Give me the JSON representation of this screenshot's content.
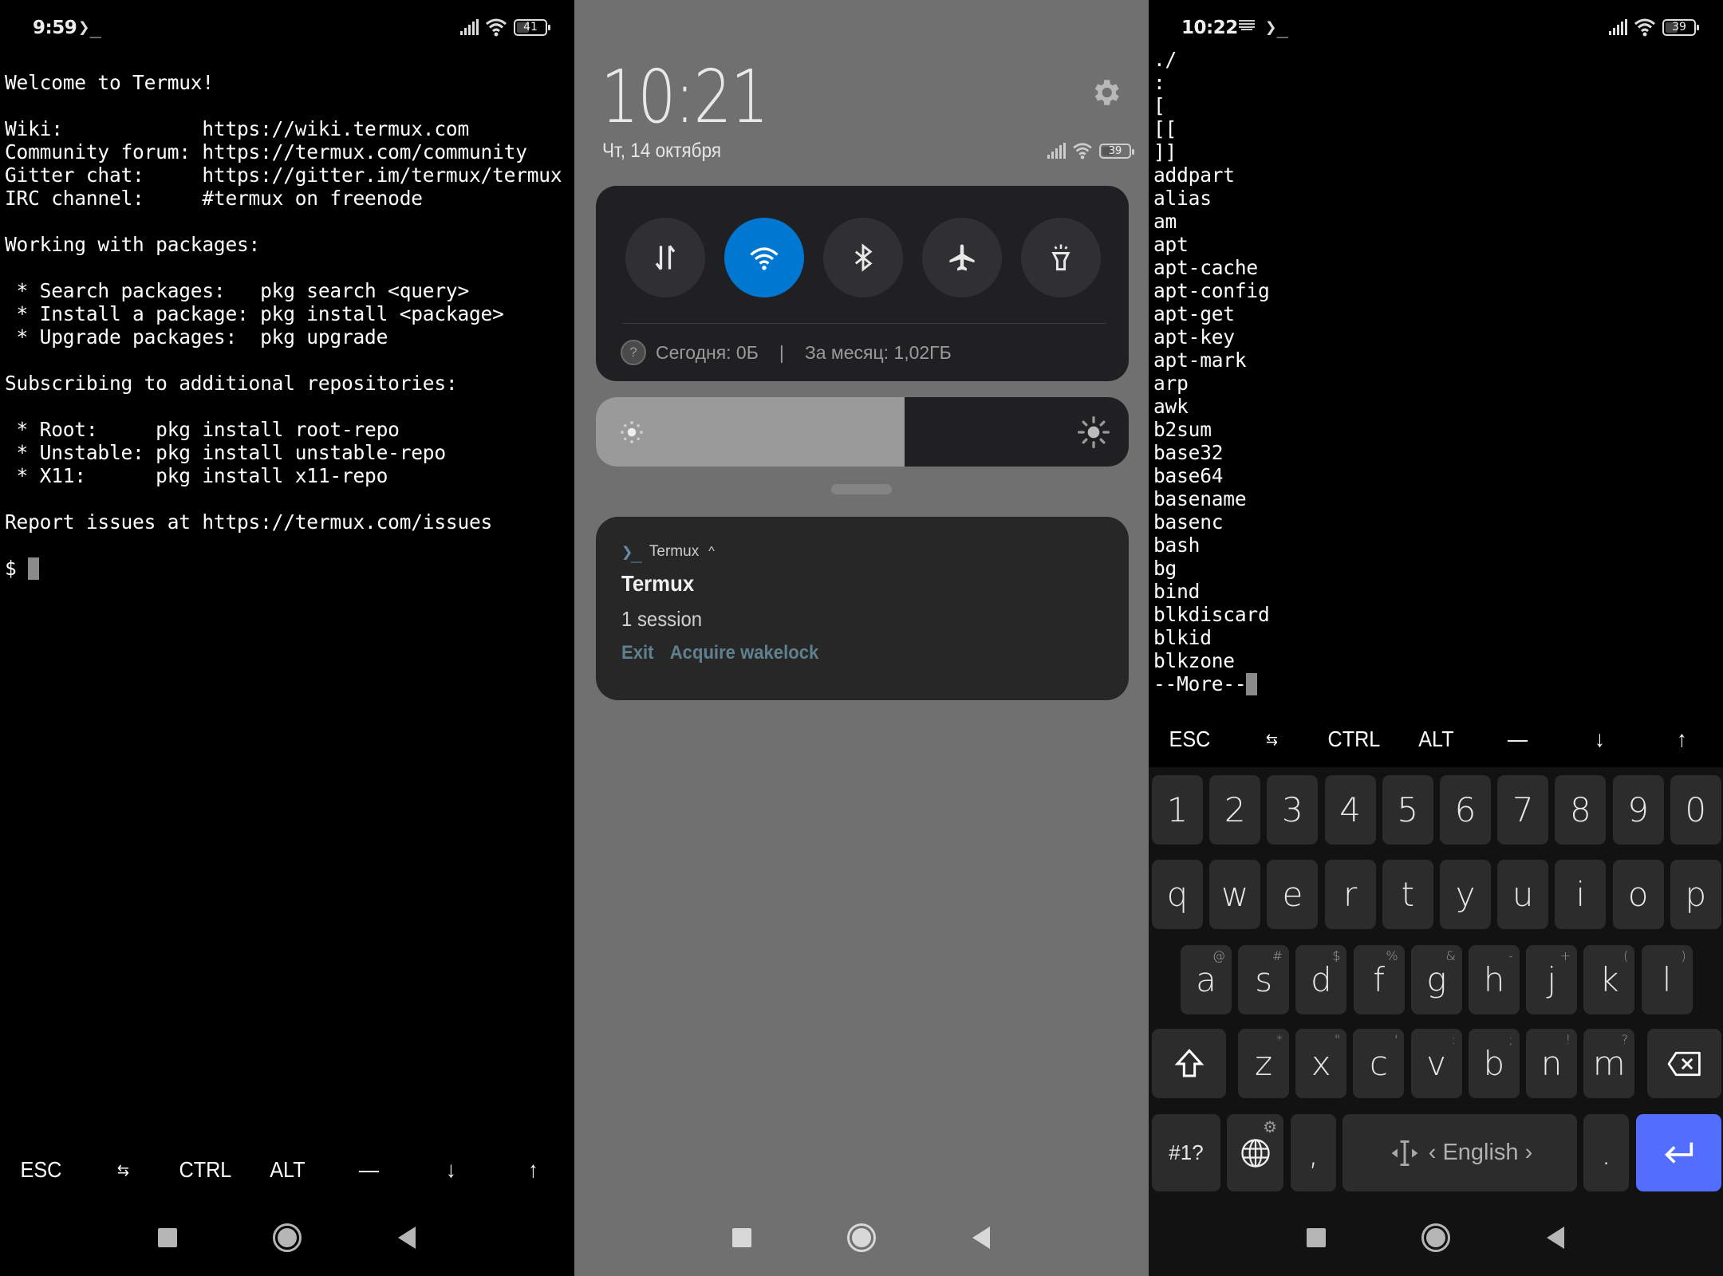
{
  "screens": {
    "left": {
      "status": {
        "time": "9:59",
        "app_icon": "❯_",
        "battery": "41"
      },
      "terminal_lines": [
        "Welcome to Termux!",
        "",
        "Wiki:            https://wiki.termux.com",
        "Community forum: https://termux.com/community",
        "Gitter chat:     https://gitter.im/termux/termux",
        "IRC channel:     #termux on freenode",
        "",
        "Working with packages:",
        "",
        " * Search packages:   pkg search <query>",
        " * Install a package: pkg install <package>",
        " * Upgrade packages:  pkg upgrade",
        "",
        "Subscribing to additional repositories:",
        "",
        " * Root:     pkg install root-repo",
        " * Unstable: pkg install unstable-repo",
        " * X11:      pkg install x11-repo",
        "",
        "Report issues at https://termux.com/issues",
        ""
      ],
      "prompt": "$ "
    },
    "middle": {
      "clock": "10:21",
      "date": "Чт, 14 октября",
      "battery": "39",
      "quick_settings": {
        "tiles": [
          {
            "name": "mobile-data",
            "active": false
          },
          {
            "name": "wifi",
            "active": true
          },
          {
            "name": "bluetooth",
            "active": false
          },
          {
            "name": "airplane-mode",
            "active": false
          },
          {
            "name": "flashlight",
            "active": false
          }
        ],
        "usage_today": "Сегодня: 0Б",
        "usage_separator": "|",
        "usage_month": "За месяц: 1,02ГБ"
      },
      "brightness_percent": 58,
      "notification": {
        "app_name": "Termux",
        "app_icon": "❯_",
        "expand_glyph": "^",
        "title": "Termux",
        "text": "1 session",
        "actions": [
          "Exit",
          "Acquire wakelock"
        ]
      },
      "colors": {
        "wifi_active": "#0077d0",
        "action_text": "#60808f"
      }
    },
    "right": {
      "status": {
        "time": "10:22",
        "app_icon": "❯_",
        "battery": "39"
      },
      "terminal_lines": [
        "./",
        ":",
        "[",
        "[[",
        "]]",
        "addpart",
        "alias",
        "am",
        "apt",
        "apt-cache",
        "apt-config",
        "apt-get",
        "apt-key",
        "apt-mark",
        "arp",
        "awk",
        "b2sum",
        "base32",
        "base64",
        "basename",
        "basenc",
        "bash",
        "bg",
        "bind",
        "blkdiscard",
        "blkid",
        "blkzone"
      ],
      "pager_prompt": "--More--",
      "keyboard": {
        "number_row": [
          "1",
          "2",
          "3",
          "4",
          "5",
          "6",
          "7",
          "8",
          "9",
          "0"
        ],
        "row1": [
          "q",
          "w",
          "e",
          "r",
          "t",
          "y",
          "u",
          "i",
          "o",
          "p"
        ],
        "row2": [
          {
            "k": "a",
            "h": "@"
          },
          {
            "k": "s",
            "h": "#"
          },
          {
            "k": "d",
            "h": "$"
          },
          {
            "k": "f",
            "h": "%"
          },
          {
            "k": "g",
            "h": "&"
          },
          {
            "k": "h",
            "h": "-"
          },
          {
            "k": "j",
            "h": "+"
          },
          {
            "k": "k",
            "h": "("
          },
          {
            "k": "l",
            "h": ")"
          }
        ],
        "row3": [
          {
            "k": "z",
            "h": "*"
          },
          {
            "k": "x",
            "h": "\""
          },
          {
            "k": "c",
            "h": "'"
          },
          {
            "k": "v",
            "h": ":"
          },
          {
            "k": "b",
            "h": ";"
          },
          {
            "k": "n",
            "h": "!"
          },
          {
            "k": "m",
            "h": "?"
          }
        ],
        "symbols_key": "#1?",
        "comma": ",",
        "period": ".",
        "space_label": "English",
        "enter_color": "#536dfe"
      }
    }
  },
  "extra_keys": [
    "ESC",
    "⇆",
    "CTRL",
    "ALT",
    "—",
    "↓",
    "↑"
  ]
}
